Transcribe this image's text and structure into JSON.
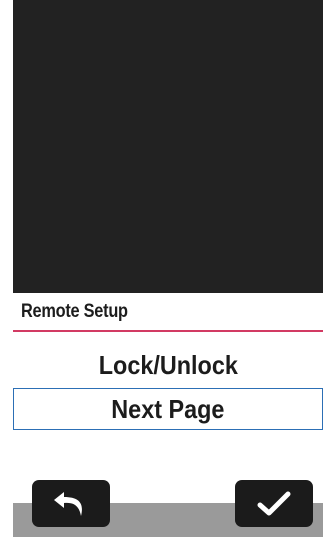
{
  "header": {
    "title": "Remote Setup"
  },
  "menu": {
    "items": [
      {
        "label": "Lock/Unlock",
        "selected": false
      },
      {
        "label": "Next Page",
        "selected": true
      }
    ]
  },
  "footer": {
    "back_icon": "back-arrow-icon",
    "confirm_icon": "checkmark-icon"
  },
  "colors": {
    "accent_underline": "#d23a63",
    "selection_border": "#2c6fb5",
    "preview_bg": "#222222",
    "bottom_bar": "#9a9a9a"
  }
}
